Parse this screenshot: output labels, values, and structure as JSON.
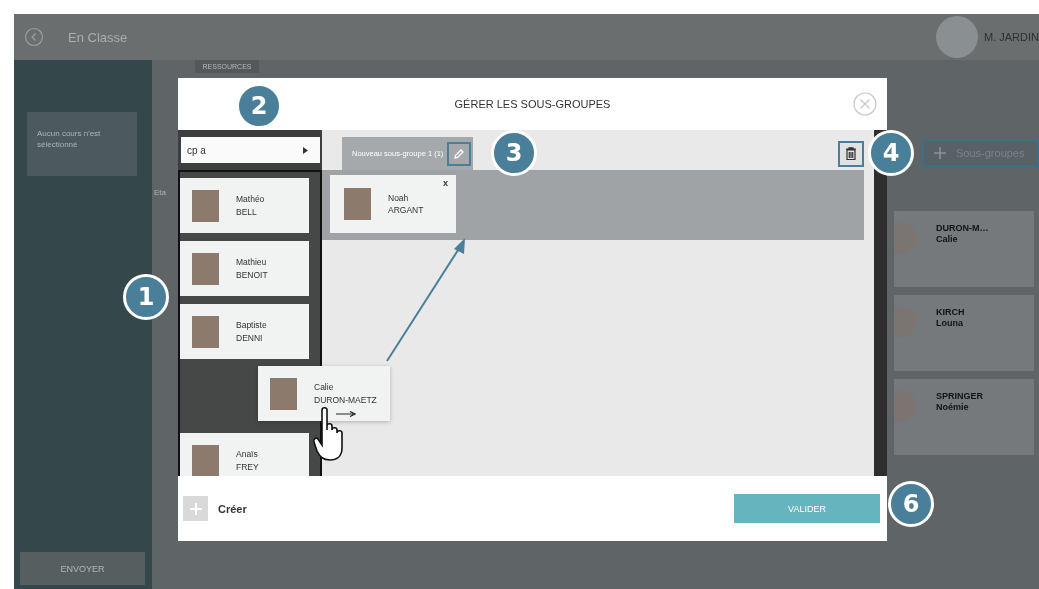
{
  "app_bar": {
    "title": "En Classe",
    "user": "M. JARDIN"
  },
  "sidebar": {
    "message": "Aucun cours n'est sélectionné",
    "send_button": "ENVOYER"
  },
  "main": {
    "tab": "RESSOURCES",
    "label": "Eta",
    "subgroups_button": "Sous-groupes",
    "students": [
      {
        "last": "DURON-M…",
        "first": "Calie"
      },
      {
        "last": "KIRCH",
        "first": "Louna"
      },
      {
        "last": "SPRINGER",
        "first": "Noémie"
      }
    ]
  },
  "dialog": {
    "title": "GÉRER LES SOUS-GROUPES",
    "class_select": "cp a",
    "students": [
      {
        "first": "Mathéo",
        "last": "BELL",
        "dragging": false
      },
      {
        "first": "Mathieu",
        "last": "BENOIT",
        "dragging": false
      },
      {
        "first": "Baptiste",
        "last": "DENNI",
        "dragging": false
      },
      {
        "first": "Calie",
        "last": "DURON-MAETZ",
        "dragging": true
      },
      {
        "first": "Anaïs",
        "last": "FREY",
        "dragging": false
      }
    ],
    "subgroup_tabs": [
      {
        "label": "Nouveau sous-groupe 1 (1)",
        "selected": true
      }
    ],
    "members": [
      {
        "first": "Noah",
        "last": "ARGANT"
      }
    ],
    "remove_mark": "x",
    "create_label": "Créer",
    "validate_button": "VALIDER"
  },
  "callouts": [
    {
      "number": "1"
    },
    {
      "number": "2"
    },
    {
      "number": "3"
    },
    {
      "number": "4"
    },
    {
      "number": "6"
    }
  ]
}
